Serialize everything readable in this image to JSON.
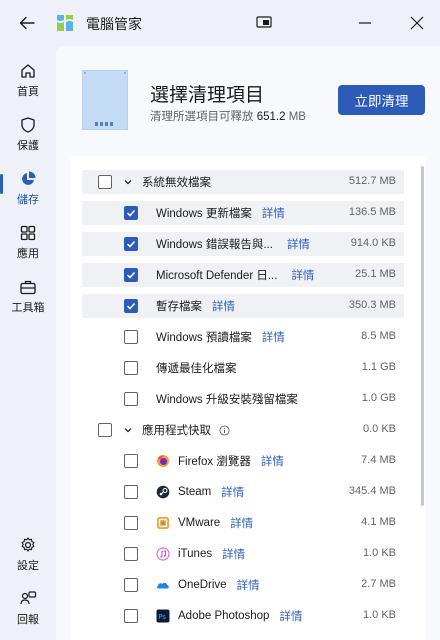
{
  "titlebar": {
    "title": "電腦管家"
  },
  "sidebar": {
    "items": [
      {
        "label": "首頁",
        "icon": "home-icon"
      },
      {
        "label": "保護",
        "icon": "shield-icon"
      },
      {
        "label": "儲存",
        "icon": "pie-chart-icon",
        "active": true
      },
      {
        "label": "應用",
        "icon": "apps-icon"
      },
      {
        "label": "工具箱",
        "icon": "toolbox-icon"
      },
      {
        "label": "設定",
        "icon": "gear-icon"
      },
      {
        "label": "回報",
        "icon": "feedback-icon"
      }
    ]
  },
  "header": {
    "title": "選擇清理項目",
    "subtitle_prefix": "清理所選項目可釋放",
    "subtitle_value": "651.2",
    "subtitle_unit": "MB",
    "clean_button": "立即清理"
  },
  "groups": [
    {
      "label": "系統無效檔案",
      "size": "512.7 MB",
      "state": "partial",
      "items": [
        {
          "label": "Windows 更新檔案",
          "detail": "詳情",
          "size": "136.5 MB",
          "checked": true
        },
        {
          "label": "Windows 錯誤報告與...",
          "detail": "詳情",
          "size": "914.0 KB",
          "checked": true
        },
        {
          "label": "Microsoft Defender 日...",
          "detail": "詳情",
          "size": "25.1 MB",
          "checked": true
        },
        {
          "label": "暫存檔案",
          "detail": "詳情",
          "size": "350.3 MB",
          "checked": true
        },
        {
          "label": "Windows 預讀檔案",
          "detail": "詳情",
          "size": "8.5 MB",
          "checked": false
        },
        {
          "label": "傳遞最佳化檔案",
          "detail": "",
          "size": "1.1 GB",
          "checked": false
        },
        {
          "label": "Windows 升級安裝殘留檔案",
          "detail": "",
          "size": "1.0 GB",
          "checked": false
        }
      ]
    },
    {
      "label": "應用程式快取",
      "size": "0.0 KB",
      "state": "unchecked",
      "items": [
        {
          "label": "Firefox 瀏覽器",
          "detail": "詳情",
          "size": "7.4 MB",
          "checked": false,
          "icon": "firefox-icon"
        },
        {
          "label": "Steam",
          "detail": "詳情",
          "size": "345.4 MB",
          "checked": false,
          "icon": "steam-icon"
        },
        {
          "label": "VMware",
          "detail": "詳情",
          "size": "4.1 MB",
          "checked": false,
          "icon": "vmware-icon"
        },
        {
          "label": "iTunes",
          "detail": "詳情",
          "size": "1.0 KB",
          "checked": false,
          "icon": "itunes-icon"
        },
        {
          "label": "OneDrive",
          "detail": "詳情",
          "size": "2.7 MB",
          "checked": false,
          "icon": "onedrive-icon"
        },
        {
          "label": "Adobe Photoshop",
          "detail": "詳情",
          "size": "1.0 KB",
          "checked": false,
          "icon": "photoshop-icon"
        }
      ]
    }
  ],
  "colors": {
    "accent": "#2d5cb8",
    "background": "#eef2f8",
    "panel": "#f7f9fc"
  }
}
